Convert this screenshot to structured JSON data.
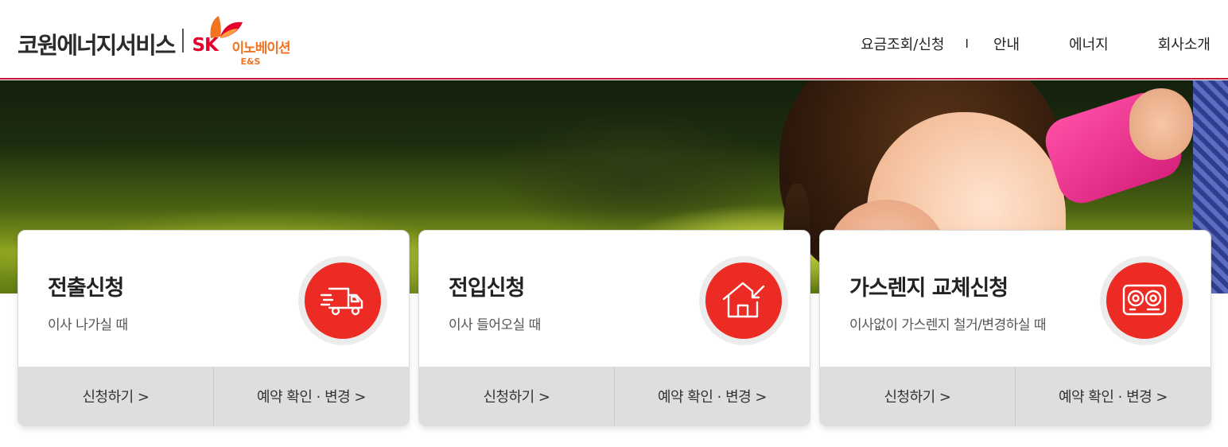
{
  "brand": {
    "company": "코원에너지서비스",
    "partner_mark": "SK",
    "partner_name": "이노베이션",
    "partner_sub": "E&S",
    "accent_color": "#c4153a",
    "sk_red": "#e4022d",
    "sk_orange": "#f37321"
  },
  "nav": {
    "items": [
      {
        "label": "요금조회/신청"
      },
      {
        "label": "안내"
      },
      {
        "label": "에너지"
      },
      {
        "label": "회사소개"
      }
    ],
    "separator": "I"
  },
  "hero": {
    "image": "hero-child-smiling-photo"
  },
  "cards": [
    {
      "title": "전출신청",
      "description": "이사 나가실 때",
      "icon": "moving-truck-icon",
      "apply_label": "신청하기 >",
      "reservation_label": "예약 확인 · 변경 >"
    },
    {
      "title": "전입신청",
      "description": "이사 들어오실 때",
      "icon": "house-move-in-icon",
      "apply_label": "신청하기 >",
      "reservation_label": "예약 확인 · 변경 >"
    },
    {
      "title": "가스렌지 교체신청",
      "description": "이사없이 가스렌지 철거/변경하실 때",
      "icon": "gas-range-icon",
      "apply_label": "신청하기 >",
      "reservation_label": "예약 확인 · 변경 >"
    }
  ],
  "colors": {
    "icon_red": "#ec2b25",
    "action_bar": "#dedede"
  }
}
